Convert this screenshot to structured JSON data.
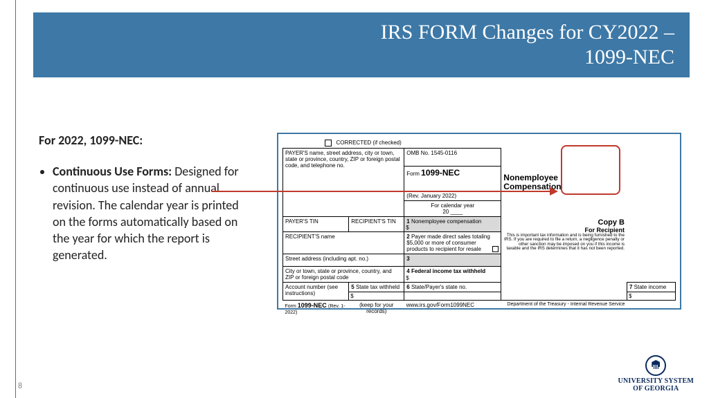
{
  "title": {
    "line1": "IRS FORM Changes for CY2022 –",
    "line2": "1099-NEC"
  },
  "body": {
    "heading": "For 2022, 1099-NEC:",
    "bullet_title": "Continuous Use Forms:",
    "bullet_text": "Designed for continuous use instead of annual revision. The calendar year is printed on the forms automatically based on the year for which the report is generated."
  },
  "form": {
    "corrected": "CORRECTED (if checked)",
    "payer_block": "PAYER'S name, street address, city or town, state or province, country, ZIP or foreign postal code, and telephone no.",
    "omb": "OMB No. 1545-0116",
    "form_label_prefix": "Form ",
    "form_label_bold": "1099-NEC",
    "rev": "(Rev. January 2022)",
    "cal_year_label": "For calendar year",
    "cal_year_prefix": "20",
    "right_header_line1": "Nonemployee",
    "right_header_line2": "Compensation",
    "payer_tin": "PAYER'S TIN",
    "recipient_tin": "RECIPIENT'S TIN",
    "box1": "Nonemployee compensation",
    "copy_b": "Copy B",
    "for_recipient": "For Recipient",
    "fine_print": "This is important tax information and is being furnished to the IRS. If you are required to file a return, a negligence penalty or other sanction may be imposed on you if this income is taxable and the IRS determines that it has not been reported.",
    "recipient_name": "RECIPIENT'S name",
    "street": "Street address (including apt. no.)",
    "city": "City or town, state or province, country, and ZIP or foreign postal code",
    "account": "Account number (see instructions)",
    "box2": "Payer made direct sales totaling $5,000 or more of consumer products to recipient for resale",
    "box3": "3",
    "box4": "Federal income tax withheld",
    "box5": "State tax withheld",
    "box6": "State/Payer's state no.",
    "box7": "State income",
    "footer_form": "Form 1099-NEC (Rev. 1-2022)",
    "footer_keep": "(keep for your records)",
    "footer_url": "www.irs.gov/Form1099NEC",
    "footer_dept": "Department of the Treasury - Internal Revenue Service"
  },
  "slide_number": "8",
  "footer": {
    "line1": "UNIVERSITY SYSTEM",
    "line2": "OF GEORGIA"
  }
}
